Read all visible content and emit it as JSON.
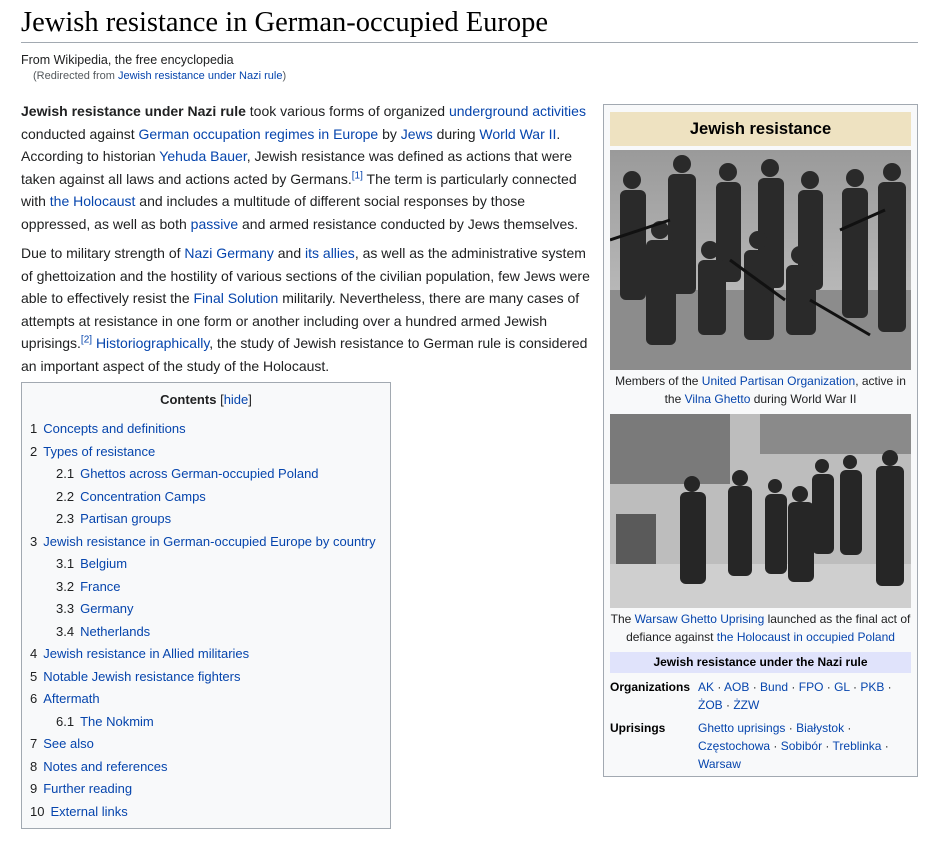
{
  "page": {
    "title": "Jewish resistance in German-occupied Europe",
    "tagline": "From Wikipedia, the free encyclopedia",
    "redirect_prefix": "(Redirected from ",
    "redirect_link": "Jewish resistance under Nazi rule",
    "redirect_suffix": ")"
  },
  "p1": {
    "bold": "Jewish resistance under Nazi rule",
    "t1": " took various forms of organized ",
    "l1": "underground activities",
    "t2": " conducted against ",
    "l2": "German occupation regimes in Europe",
    "t3": " by ",
    "l3": "Jews",
    "t4": " during ",
    "l4": "World War II",
    "t5": ". According to historian ",
    "l5": "Yehuda Bauer",
    "t6": ", Jewish resistance was defined as actions that were taken against all laws and actions acted by Germans.",
    "ref1": "[1]",
    "t7": " The term is particularly connected with ",
    "l6": "the Holocaust",
    "t8": " and includes a multitude of different social responses by those oppressed, as well as both ",
    "l7": "passive",
    "t9": " and armed resistance conducted by Jews themselves."
  },
  "p2": {
    "t1": "Due to military strength of ",
    "l1": "Nazi Germany",
    "t2": " and ",
    "l2": "its allies",
    "t3": ", as well as the administrative system of ghettoization and the hostility of various sections of the civilian population, few Jews were able to effectively resist the ",
    "l3": "Final Solution",
    "t4": " militarily. Nevertheless, there are many cases of attempts at resistance in one form or another including over a hundred armed Jewish uprisings.",
    "ref2": "[2]",
    "t5": " ",
    "l4": "Historiographically",
    "t6": ", the study of Jewish resistance to German rule is considered an important aspect of the study of the Holocaust."
  },
  "toc": {
    "title": "Contents",
    "hide_open": "[",
    "hide": "hide",
    "hide_close": "]",
    "items": [
      {
        "num": "1",
        "label": "Concepts and definitions"
      },
      {
        "num": "2",
        "label": "Types of resistance"
      },
      {
        "num": "2.1",
        "label": "Ghettos across German-occupied Poland"
      },
      {
        "num": "2.2",
        "label": "Concentration Camps"
      },
      {
        "num": "2.3",
        "label": "Partisan groups"
      },
      {
        "num": "3",
        "label": "Jewish resistance in German-occupied Europe by country"
      },
      {
        "num": "3.1",
        "label": "Belgium"
      },
      {
        "num": "3.2",
        "label": "France"
      },
      {
        "num": "3.3",
        "label": "Germany"
      },
      {
        "num": "3.4",
        "label": "Netherlands"
      },
      {
        "num": "4",
        "label": "Jewish resistance in Allied militaries"
      },
      {
        "num": "5",
        "label": "Notable Jewish resistance fighters"
      },
      {
        "num": "6",
        "label": "Aftermath"
      },
      {
        "num": "6.1",
        "label": "The Nokmim"
      },
      {
        "num": "7",
        "label": "See also"
      },
      {
        "num": "8",
        "label": "Notes and references"
      },
      {
        "num": "9",
        "label": "Further reading"
      },
      {
        "num": "10",
        "label": "External links"
      }
    ]
  },
  "infobox": {
    "title": "Jewish resistance",
    "cap1": {
      "t1": "Members of the ",
      "l1": "United Partisan Organization",
      "t2": ", active in the ",
      "l2": "Vilna Ghetto",
      "t3": " during World War II"
    },
    "cap2": {
      "t1": "The ",
      "l1": "Warsaw Ghetto Uprising",
      "t2": " launched as the final act of defiance against ",
      "l2": "the Holocaust in occupied Poland"
    },
    "header": "Jewish resistance under the Nazi rule",
    "org_label": "Organizations",
    "orgs": [
      "AK",
      "AOB",
      "Bund",
      "FPO",
      "GL",
      "PKB",
      "ŻOB",
      "ŻZW"
    ],
    "upr_label": "Uprisings",
    "uprisings": [
      "Ghetto uprisings",
      "Białystok",
      "Częstochowa",
      "Sobibór",
      "Treblinka",
      "Warsaw"
    ],
    "separator": " · "
  },
  "colors": {
    "link": "#0645ad",
    "infobox_title_bg": "#eee2c1",
    "infobox_header_bg": "#e0e3fb",
    "toc_bg": "#f8f9fa",
    "border": "#a2a9b1"
  }
}
